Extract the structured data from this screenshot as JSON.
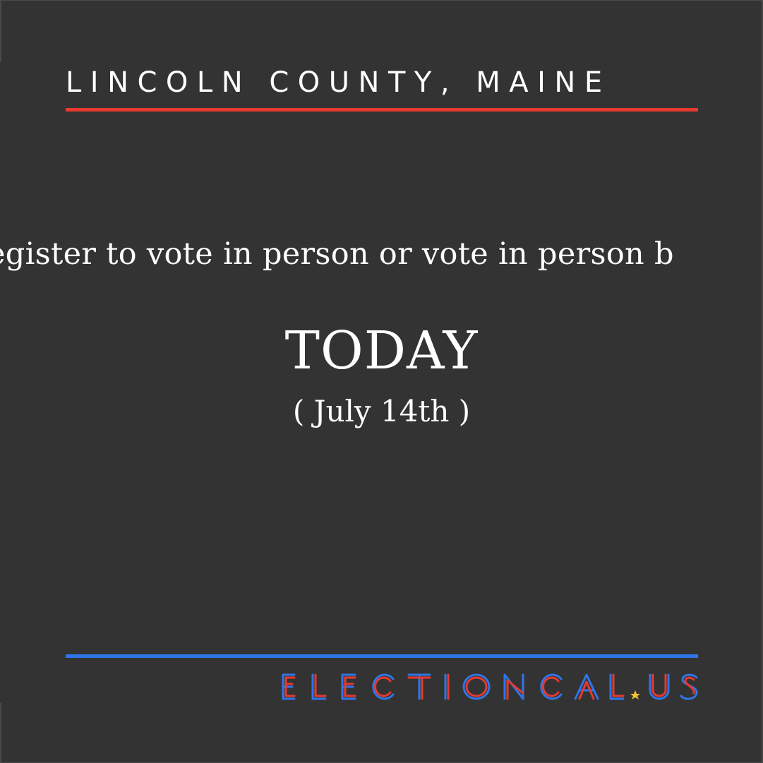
{
  "header": {
    "location": "LINCOLN COUNTY, MAINE"
  },
  "message": {
    "text": "egister to vote in person or vote in person b"
  },
  "deadline": {
    "label": "TODAY",
    "date": "( July 14th )"
  },
  "brand": {
    "name": "ELECTIONCAL.US",
    "red": "#e8392f",
    "blue": "#2f76e8",
    "star": "#f2c230"
  },
  "colors": {
    "background": "#333333",
    "text": "#ffffff",
    "top_rule": "#e8392f",
    "bottom_rule": "#2f76e8"
  }
}
